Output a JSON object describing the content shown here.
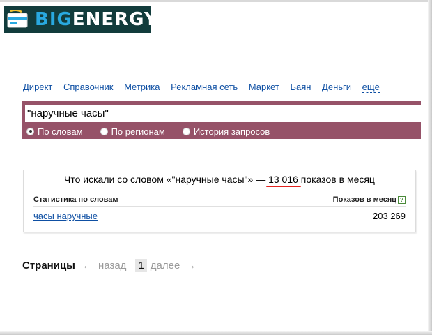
{
  "logo": {
    "text_part1": "BIG",
    "text_part2": "ENERGY"
  },
  "nav": {
    "items": [
      "Директ",
      "Справочник",
      "Метрика",
      "Рекламная сеть",
      "Маркет",
      "Баян",
      "Деньги",
      "ещё"
    ]
  },
  "search": {
    "value": "\"наручные часы\"",
    "modes": [
      {
        "label": "По словам",
        "selected": true
      },
      {
        "label": "По регионам",
        "selected": false
      },
      {
        "label": "История запросов",
        "selected": false
      }
    ]
  },
  "stats": {
    "summary_prefix": "Что искали со словом «\"наручные часы\"» — ",
    "summary_count": "13 016",
    "summary_suffix": " показов в месяц",
    "col_left": "Статистика по словам",
    "col_right": "Показов в месяц",
    "help_glyph": "?",
    "rows": [
      {
        "phrase": "часы наручные",
        "count": "203 269"
      }
    ]
  },
  "pager": {
    "title": "Страницы",
    "prev_arrow": "←",
    "prev": "назад",
    "current": "1",
    "next": "далее",
    "next_arrow": "→"
  },
  "colors": {
    "search_bar": "#965268",
    "link": "#0e4fa3",
    "highlight_underline": "#e2221f",
    "logo_bg": "#123c3c",
    "logo_accent": "#29a9e0"
  }
}
